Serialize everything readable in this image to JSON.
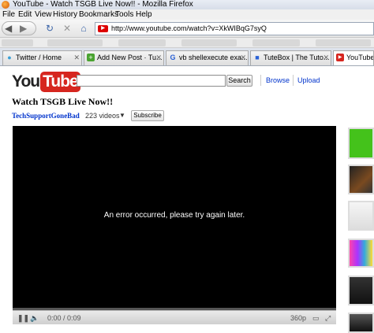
{
  "window": {
    "title": "YouTube - Watch TSGB Live Now!! - Mozilla Firefox"
  },
  "menu": [
    "File",
    "Edit",
    "View",
    "History",
    "Bookmarks",
    "Tools",
    "Help"
  ],
  "address": {
    "url": "http://www.youtube.com/watch?v=XkWIBqG7syQ"
  },
  "tabs": [
    {
      "label": "Twitter / Home",
      "icon": "twitter-icon"
    },
    {
      "label": "Add New Post · Tu...",
      "icon": "wordpress-icon"
    },
    {
      "label": "vb shellexecute exa...",
      "icon": "google-icon"
    },
    {
      "label": "TuteBox | The Tuto...",
      "icon": "page-icon"
    },
    {
      "label": "YouTube - ",
      "icon": "youtube-icon",
      "active": true
    }
  ],
  "header": {
    "logo_you": "You",
    "logo_tube": "Tube",
    "search_button": "Search",
    "browse": "Browse",
    "upload": "Upload"
  },
  "video": {
    "title": "Watch TSGB Live Now!!",
    "channel": "TechSupportGoneBad",
    "video_count": "223 videos",
    "subscribe": "Subscribe",
    "error_message": "An error occurred, please try again later.",
    "time": "0:00 / 0:09",
    "quality": "360p",
    "progress": 0
  },
  "colors": {
    "brand_red": "#d6261f",
    "link_blue": "#0033cc",
    "player_bg": "#000000"
  }
}
